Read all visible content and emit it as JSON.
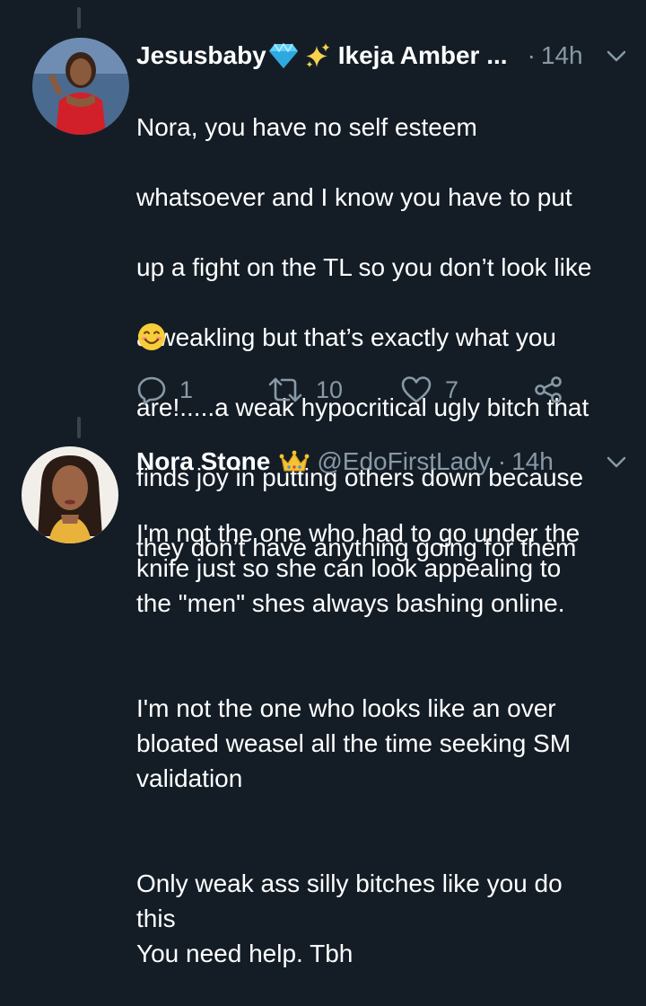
{
  "tweets": [
    {
      "display_name": "Jesusbaby",
      "name_suffix": "Ikeja Amber ...",
      "dot": "·",
      "time": "14h",
      "avatar_icon": "avatar-woman-red-dress",
      "badges": [
        "gem-icon",
        "sparkles-icon"
      ],
      "lines": [
        "Nora, you have no self esteem",
        "whatsoever and I know you have to put",
        "up a fight on the TL so you don’t look like",
        "a weakling but that’s exactly what you",
        "are!.....a weak hypocritical ugly bitch that",
        "finds joy in putting others down because",
        "they don’t have anything going for them"
      ],
      "emoji": "smiling-face-icon",
      "actions": {
        "reply_count": "1",
        "retweet_count": "10",
        "like_count": "7"
      }
    },
    {
      "display_name": "Nora Stone",
      "handle": "@EdoFirstLady",
      "dot": "·",
      "time": "14h",
      "avatar_icon": "avatar-woman-portrait",
      "badges": [
        "crown-icon"
      ],
      "paragraphs": [
        "I'm not the one who had to go under the\nknife just so she can look appealing to\nthe \"men\" shes always bashing online.",
        "I'm not the one who looks like an over\nbloated weasel all the time seeking SM\nvalidation",
        "Only weak ass silly bitches like you do\nthis\nYou need help. Tbh"
      ]
    }
  ],
  "colors": {
    "background": "#141d26",
    "text": "#ffffff",
    "muted": "#8899a6",
    "thread_line": "#38444d"
  }
}
